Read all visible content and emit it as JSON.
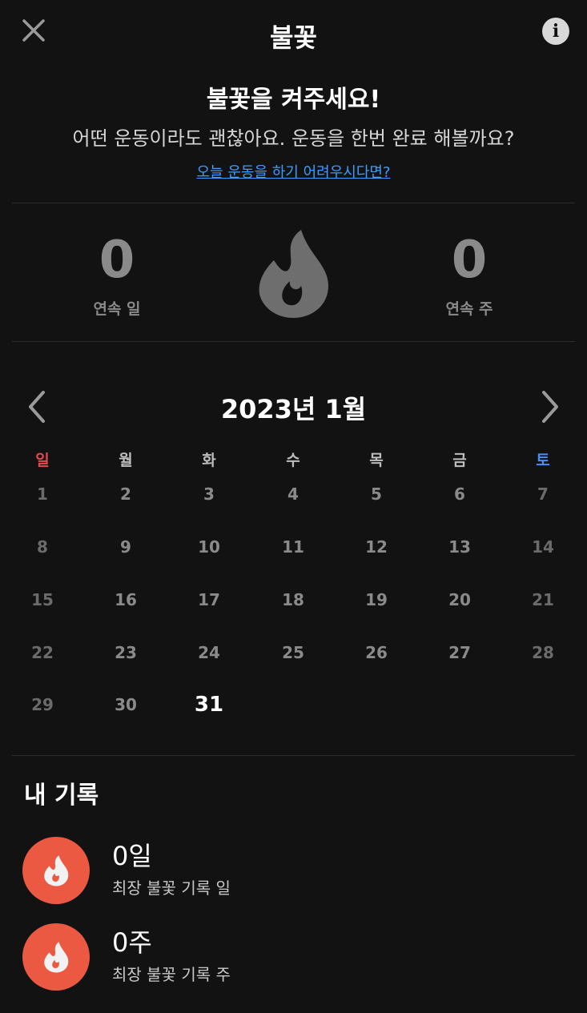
{
  "header": {
    "title": "불꽃",
    "close_icon": "close-icon",
    "info_glyph": "i"
  },
  "intro": {
    "heading": "불꽃을 켜주세요!",
    "subtitle": "어떤 운동이라도 괜찮아요. 운동을 한번 완료 해볼까요?",
    "link": "오늘 운동을 하기 어려우시다면?"
  },
  "streak": {
    "days_value": "0",
    "days_label": "연속 일",
    "weeks_value": "0",
    "weeks_label": "연속 주",
    "icon": "flame-icon"
  },
  "calendar": {
    "title": "2023년 1월",
    "weekdays": [
      "일",
      "월",
      "화",
      "수",
      "목",
      "금",
      "토"
    ],
    "days": [
      "1",
      "2",
      "3",
      "4",
      "5",
      "6",
      "7",
      "8",
      "9",
      "10",
      "11",
      "12",
      "13",
      "14",
      "15",
      "16",
      "17",
      "18",
      "19",
      "20",
      "21",
      "22",
      "23",
      "24",
      "25",
      "26",
      "27",
      "28",
      "29",
      "30",
      "31"
    ],
    "today": "31"
  },
  "records": {
    "title": "내 기록",
    "items": [
      {
        "value": "0일",
        "label": "최장 불꽃 기록 일"
      },
      {
        "value": "0주",
        "label": "최장 불꽃 기록 주"
      }
    ]
  },
  "colors": {
    "background": "#121212",
    "sunday": "#e5484d",
    "saturday": "#4a8df8",
    "link": "#3f9cff",
    "record_badge": "#ec5943",
    "muted": "#8a8a8a"
  }
}
